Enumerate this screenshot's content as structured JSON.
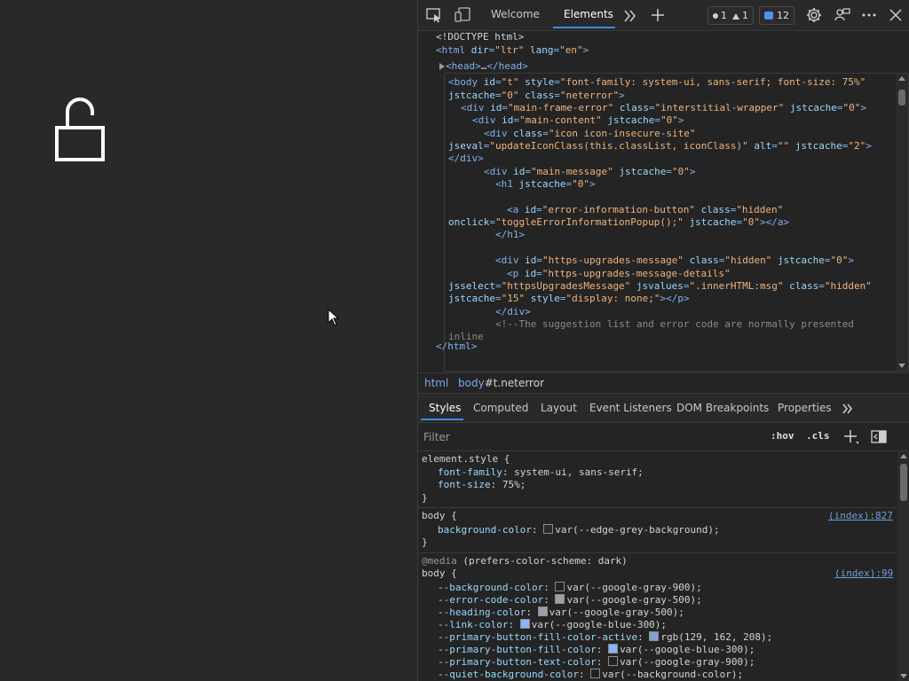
{
  "devtools": {
    "tabs": [
      {
        "label": "Welcome"
      },
      {
        "label": "Elements"
      }
    ],
    "badges": {
      "errors": "1",
      "warnings": "1",
      "messages": "12"
    }
  },
  "dom": {
    "lines": [
      {
        "tokens": [
          {
            "t": "txt",
            "v": "<!DOCTYPE html>"
          }
        ]
      },
      {
        "tokens": [
          {
            "t": "tagc",
            "v": "<html "
          },
          {
            "t": "attr",
            "v": "dir"
          },
          {
            "t": "tagc",
            "v": "="
          },
          {
            "t": "val",
            "v": "\"ltr\""
          },
          {
            "t": "tagc",
            "v": " "
          },
          {
            "t": "attr",
            "v": "lang"
          },
          {
            "t": "tagc",
            "v": "="
          },
          {
            "t": "val",
            "v": "\"en\""
          },
          {
            "t": "tagc",
            "v": ">"
          }
        ]
      },
      {
        "tokens": [
          {
            "t": "tagc",
            "v": "<head>"
          },
          {
            "t": "txt",
            "v": "…"
          },
          {
            "t": "tagc",
            "v": "</head>"
          }
        ]
      },
      {
        "tokens": [
          {
            "t": "tagc",
            "v": "<body "
          },
          {
            "t": "attr",
            "v": "id"
          },
          {
            "t": "tagc",
            "v": "="
          },
          {
            "t": "val",
            "v": "\"t\""
          },
          {
            "t": "tagc",
            "v": " "
          },
          {
            "t": "attr",
            "v": "style"
          },
          {
            "t": "tagc",
            "v": "="
          },
          {
            "t": "val",
            "v": "\"font-family: system-ui, sans-serif; font-size: 75%\""
          }
        ]
      },
      {
        "tokens": [
          {
            "t": "attr",
            "v": "jstcache"
          },
          {
            "t": "tagc",
            "v": "="
          },
          {
            "t": "val",
            "v": "\"0\""
          },
          {
            "t": "tagc",
            "v": " "
          },
          {
            "t": "attr",
            "v": "class"
          },
          {
            "t": "tagc",
            "v": "="
          },
          {
            "t": "val",
            "v": "\"neterror\""
          },
          {
            "t": "tagc",
            "v": ">"
          }
        ]
      },
      {
        "tokens": [
          {
            "t": "tagc",
            "v": "<div "
          },
          {
            "t": "attr",
            "v": "id"
          },
          {
            "t": "tagc",
            "v": "="
          },
          {
            "t": "val",
            "v": "\"main-frame-error\""
          },
          {
            "t": "tagc",
            "v": " "
          },
          {
            "t": "attr",
            "v": "class"
          },
          {
            "t": "tagc",
            "v": "="
          },
          {
            "t": "val",
            "v": "\"interstitial-wrapper\""
          },
          {
            "t": "tagc",
            "v": " "
          },
          {
            "t": "attr",
            "v": "jstcache"
          },
          {
            "t": "tagc",
            "v": "="
          },
          {
            "t": "val",
            "v": "\"0\""
          },
          {
            "t": "tagc",
            "v": ">"
          }
        ]
      },
      {
        "tokens": [
          {
            "t": "tagc",
            "v": "<div "
          },
          {
            "t": "attr",
            "v": "id"
          },
          {
            "t": "tagc",
            "v": "="
          },
          {
            "t": "val",
            "v": "\"main-content\""
          },
          {
            "t": "tagc",
            "v": " "
          },
          {
            "t": "attr",
            "v": "jstcache"
          },
          {
            "t": "tagc",
            "v": "="
          },
          {
            "t": "val",
            "v": "\"0\""
          },
          {
            "t": "tagc",
            "v": ">"
          }
        ]
      },
      {
        "tokens": [
          {
            "t": "tagc",
            "v": "<div "
          },
          {
            "t": "attr",
            "v": "class"
          },
          {
            "t": "tagc",
            "v": "="
          },
          {
            "t": "val",
            "v": "\"icon icon-insecure-site\""
          }
        ]
      },
      {
        "tokens": [
          {
            "t": "attr",
            "v": "jseval"
          },
          {
            "t": "tagc",
            "v": "="
          },
          {
            "t": "val",
            "v": "\"updateIconClass(this.classList, iconClass)\""
          },
          {
            "t": "tagc",
            "v": " "
          },
          {
            "t": "attr",
            "v": "alt"
          },
          {
            "t": "tagc",
            "v": "="
          },
          {
            "t": "val",
            "v": "\"\""
          },
          {
            "t": "tagc",
            "v": " "
          },
          {
            "t": "attr",
            "v": "jstcache"
          },
          {
            "t": "tagc",
            "v": "="
          },
          {
            "t": "val",
            "v": "\"2\""
          },
          {
            "t": "tagc",
            "v": ">"
          }
        ]
      },
      {
        "tokens": [
          {
            "t": "tagc",
            "v": "</div>"
          }
        ]
      },
      {
        "tokens": [
          {
            "t": "tagc",
            "v": "<div "
          },
          {
            "t": "attr",
            "v": "id"
          },
          {
            "t": "tagc",
            "v": "="
          },
          {
            "t": "val",
            "v": "\"main-message\""
          },
          {
            "t": "tagc",
            "v": " "
          },
          {
            "t": "attr",
            "v": "jstcache"
          },
          {
            "t": "tagc",
            "v": "="
          },
          {
            "t": "val",
            "v": "\"0\""
          },
          {
            "t": "tagc",
            "v": ">"
          }
        ]
      },
      {
        "tokens": [
          {
            "t": "tagc",
            "v": "<h1 "
          },
          {
            "t": "attr",
            "v": "jstcache"
          },
          {
            "t": "tagc",
            "v": "="
          },
          {
            "t": "val",
            "v": "\"0\""
          },
          {
            "t": "tagc",
            "v": ">"
          }
        ]
      },
      {
        "tokens": []
      },
      {
        "tokens": [
          {
            "t": "tagc",
            "v": "<a "
          },
          {
            "t": "attr",
            "v": "id"
          },
          {
            "t": "tagc",
            "v": "="
          },
          {
            "t": "val",
            "v": "\"error-information-button\""
          },
          {
            "t": "tagc",
            "v": " "
          },
          {
            "t": "attr",
            "v": "class"
          },
          {
            "t": "tagc",
            "v": "="
          },
          {
            "t": "val",
            "v": "\"hidden\""
          }
        ]
      },
      {
        "tokens": [
          {
            "t": "attr",
            "v": "onclick"
          },
          {
            "t": "tagc",
            "v": "="
          },
          {
            "t": "val",
            "v": "\"toggleErrorInformationPopup();\""
          },
          {
            "t": "tagc",
            "v": " "
          },
          {
            "t": "attr",
            "v": "jstcache"
          },
          {
            "t": "tagc",
            "v": "="
          },
          {
            "t": "val",
            "v": "\"0\""
          },
          {
            "t": "tagc",
            "v": "></a>"
          }
        ]
      },
      {
        "tokens": [
          {
            "t": "tagc",
            "v": "</h1>"
          }
        ]
      },
      {
        "tokens": []
      },
      {
        "tokens": [
          {
            "t": "tagc",
            "v": "<div "
          },
          {
            "t": "attr",
            "v": "id"
          },
          {
            "t": "tagc",
            "v": "="
          },
          {
            "t": "val",
            "v": "\"https-upgrades-message\""
          },
          {
            "t": "tagc",
            "v": " "
          },
          {
            "t": "attr",
            "v": "class"
          },
          {
            "t": "tagc",
            "v": "="
          },
          {
            "t": "val",
            "v": "\"hidden\""
          },
          {
            "t": "tagc",
            "v": " "
          },
          {
            "t": "attr",
            "v": "jstcache"
          },
          {
            "t": "tagc",
            "v": "="
          },
          {
            "t": "val",
            "v": "\"0\""
          },
          {
            "t": "tagc",
            "v": ">"
          }
        ]
      },
      {
        "tokens": [
          {
            "t": "tagc",
            "v": "<p "
          },
          {
            "t": "attr",
            "v": "id"
          },
          {
            "t": "tagc",
            "v": "="
          },
          {
            "t": "val",
            "v": "\"https-upgrades-message-details\""
          }
        ]
      },
      {
        "tokens": [
          {
            "t": "attr",
            "v": "jsselect"
          },
          {
            "t": "tagc",
            "v": "="
          },
          {
            "t": "val",
            "v": "\"httpsUpgradesMessage\""
          },
          {
            "t": "tagc",
            "v": " "
          },
          {
            "t": "attr",
            "v": "jsvalues"
          },
          {
            "t": "tagc",
            "v": "="
          },
          {
            "t": "val",
            "v": "\".innerHTML:msg\""
          },
          {
            "t": "tagc",
            "v": " "
          },
          {
            "t": "attr",
            "v": "class"
          },
          {
            "t": "tagc",
            "v": "="
          },
          {
            "t": "val",
            "v": "\"hidden\""
          }
        ]
      },
      {
        "tokens": [
          {
            "t": "attr",
            "v": "jstcache"
          },
          {
            "t": "tagc",
            "v": "="
          },
          {
            "t": "val",
            "v": "\"15\""
          },
          {
            "t": "tagc",
            "v": " "
          },
          {
            "t": "attr",
            "v": "style"
          },
          {
            "t": "tagc",
            "v": "="
          },
          {
            "t": "val",
            "v": "\"display: none;\""
          },
          {
            "t": "tagc",
            "v": "></p>"
          }
        ]
      },
      {
        "tokens": [
          {
            "t": "tagc",
            "v": "</div>"
          }
        ]
      },
      {
        "tokens": [
          {
            "t": "cmt",
            "v": "<!--The suggestion list and error code are normally presented"
          }
        ]
      },
      {
        "tokens": [
          {
            "t": "cmt",
            "v": "inline"
          }
        ]
      },
      {
        "tokens": [
          {
            "t": "tagc",
            "v": "</html>"
          }
        ]
      }
    ]
  },
  "breadcrumbs": {
    "html": "html",
    "body_tag": "body",
    "body_rest": "#t.neterror"
  },
  "subtabs": [
    "Styles",
    "Computed",
    "Layout",
    "Event Listeners",
    "DOM Breakpoints",
    "Properties"
  ],
  "filter": {
    "placeholder": "Filter",
    "hov": ":hov",
    "cls": ".cls"
  },
  "styles": {
    "element_style_sel": "element.style {",
    "element_props": [
      {
        "name": "font-family",
        "value": "system-ui, sans-serif;"
      },
      {
        "name": "font-size",
        "value": "75%;"
      }
    ],
    "close": "}",
    "body_rule_sel": "body {",
    "body_rule_link": "(index):827",
    "body_rule_prop": {
      "name": "background-color",
      "value": "var(--edge-grey-background);",
      "swatch": "#2b2b2b"
    },
    "media_at": "@media",
    "media_query": "(prefers-color-scheme: dark)",
    "media_body_sel": "body {",
    "media_link": "(index):99",
    "media_props": [
      {
        "name": "--background-color",
        "value": "var(--google-gray-900);",
        "swatch": "#202124"
      },
      {
        "name": "--error-code-color",
        "value": "var(--google-gray-500);",
        "swatch": "#9aa0a6"
      },
      {
        "name": "--heading-color",
        "value": "var(--google-gray-500);",
        "swatch": "#9aa0a6"
      },
      {
        "name": "--link-color",
        "value": "var(--google-blue-300);",
        "swatch": "#8ab4f8"
      },
      {
        "name": "--primary-button-fill-color-active",
        "value": "rgb(129, 162, 208);",
        "swatch": "#81a2d0"
      },
      {
        "name": "--primary-button-fill-color",
        "value": "var(--google-blue-300);",
        "swatch": "#8ab4f8"
      },
      {
        "name": "--primary-button-text-color",
        "value": "var(--google-gray-900);",
        "swatch": "#202124"
      },
      {
        "name": "--quiet-background-color",
        "value": "var(--background-color);",
        "swatch": "#202124"
      }
    ]
  },
  "colors": {
    "accent": "#3d8ee6",
    "page_bg": "#292929",
    "devtools_bg": "#242424"
  }
}
